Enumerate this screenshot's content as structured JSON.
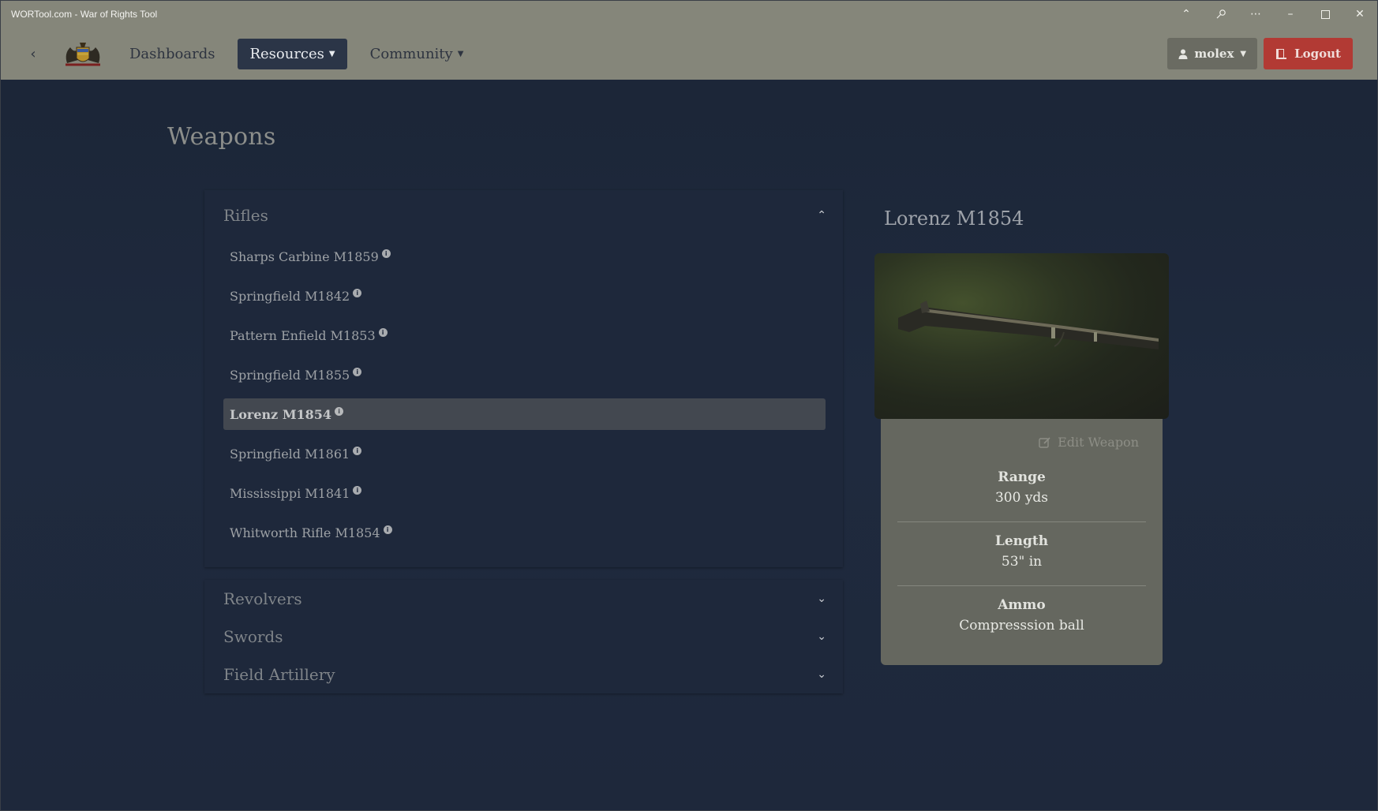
{
  "window": {
    "title": "WORTool.com - War of Rights Tool"
  },
  "navbar": {
    "links": [
      {
        "label": "Dashboards",
        "active": false
      },
      {
        "label": "Resources",
        "active": true
      },
      {
        "label": "Community",
        "active": false
      }
    ],
    "user_label": "molex",
    "logout_label": "Logout"
  },
  "page": {
    "title": "Weapons"
  },
  "accordion": {
    "rifles": {
      "label": "Rifles",
      "expanded": true,
      "items": [
        {
          "name": "Sharps Carbine M1859"
        },
        {
          "name": "Springfield M1842"
        },
        {
          "name": "Pattern Enfield M1853"
        },
        {
          "name": "Springfield M1855"
        },
        {
          "name": "Lorenz M1854",
          "selected": true
        },
        {
          "name": "Springfield M1861"
        },
        {
          "name": "Mississippi M1841"
        },
        {
          "name": "Whitworth Rifle M1854"
        }
      ]
    },
    "revolvers": {
      "label": "Revolvers",
      "expanded": false
    },
    "swords": {
      "label": "Swords",
      "expanded": false
    },
    "artillery": {
      "label": "Field Artillery",
      "expanded": false
    }
  },
  "detail": {
    "name": "Lorenz M1854",
    "edit_label": "Edit Weapon",
    "stats": [
      {
        "label": "Range",
        "value": "300 yds"
      },
      {
        "label": "Length",
        "value": "53\" in"
      },
      {
        "label": "Ammo",
        "value": "Compresssion ball"
      }
    ]
  },
  "colors": {
    "navbar_bg": "#85867a",
    "active_nav_bg": "#2b3547",
    "logout_bg": "#b23a34",
    "page_bg": "#1f2a3f",
    "card_bg": "#65675f"
  }
}
